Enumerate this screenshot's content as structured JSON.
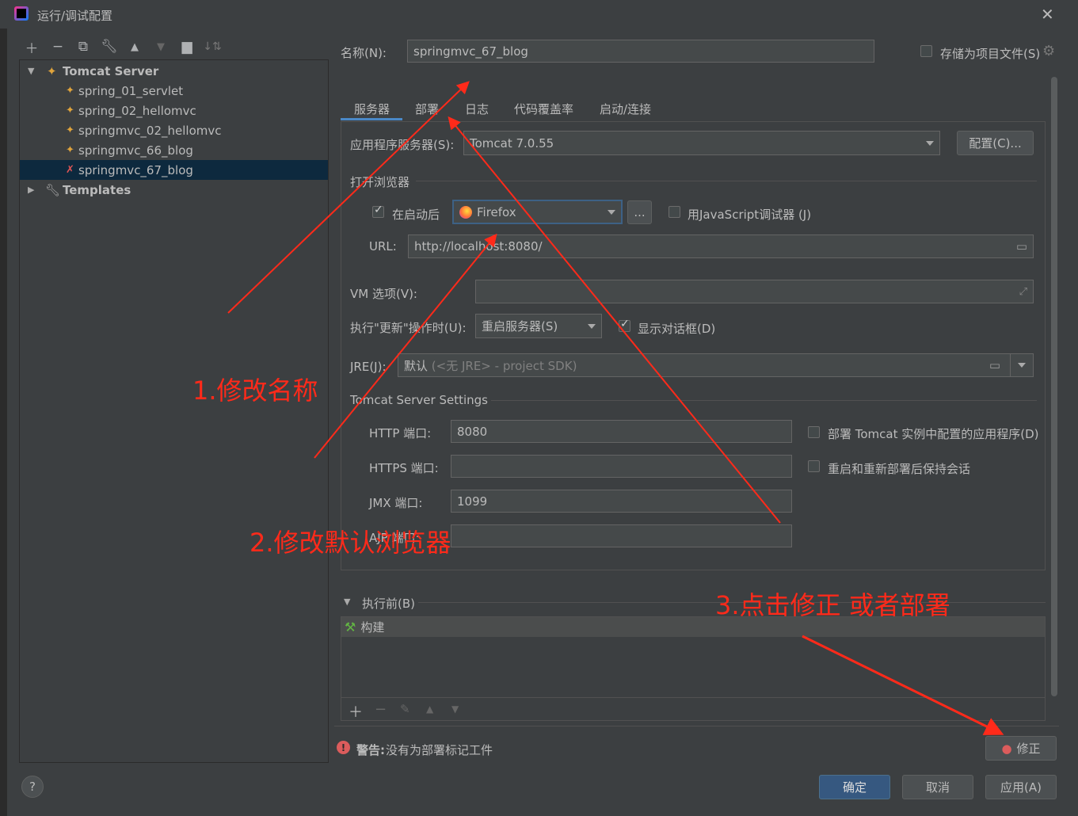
{
  "window": {
    "title": "运行/调试配置",
    "close": "✕"
  },
  "toolbar": {
    "icons": [
      "plus-icon",
      "minus-icon",
      "copy-icon",
      "wrench-icon",
      "arrow-up-icon",
      "arrow-down-icon",
      "folder-add-icon",
      "sort-icon"
    ]
  },
  "tree": {
    "group": "Tomcat Server",
    "items": [
      "spring_01_servlet",
      "spring_02_hellomvc",
      "springmvc_02_hellomvc",
      "springmvc_66_blog",
      "springmvc_67_blog"
    ],
    "selected": "springmvc_67_blog",
    "templates": "Templates"
  },
  "name": {
    "label": "名称(N):",
    "value": "springmvc_67_blog"
  },
  "store": {
    "label": "存储为项目文件(S)"
  },
  "tabs": [
    "服务器",
    "部署",
    "日志",
    "代码覆盖率",
    "启动/连接"
  ],
  "server": {
    "app_server_label": "应用程序服务器(S):",
    "app_server_value": "Tomcat 7.0.55",
    "config_button": "配置(C)...",
    "open_browser_label": "打开浏览器",
    "after_launch_label": "在启动后",
    "browser_value": "Firefox",
    "browse_btn": "...",
    "js_debugger_label": "用JavaScript调试器 (J)",
    "url_label": "URL:",
    "url_value": "http://localhost:8080/",
    "vm_label": "VM 选项(V):",
    "vm_value": "",
    "update_label": "执行\"更新\"操作时(U):",
    "update_value": "重启服务器(S)",
    "show_dialog_label": "显示对话框(D)",
    "jre_label": "JRE(J):",
    "jre_value_main": "默认",
    "jre_value_hint": "(<无 JRE> - project SDK)",
    "tomcat_settings_label": "Tomcat Server Settings",
    "http_label": "HTTP 端口:",
    "http_value": "8080",
    "https_label": "HTTPS 端口:",
    "https_value": "",
    "jmx_label": "JMX 端口:",
    "jmx_value": "1099",
    "ajp_label": "AJP 端口:",
    "ajp_value": "",
    "deploy_tomcat_label": "部署 Tomcat 实例中配置的应用程序(D)",
    "keep_session_label": "重启和重新部署后保持会话"
  },
  "before_launch": {
    "label": "执行前(B)",
    "items": [
      "构建"
    ]
  },
  "warning": {
    "prefix": "警告:",
    "text": "没有为部署标记工件",
    "fix_button": "修正"
  },
  "footer": {
    "ok": "确定",
    "cancel": "取消",
    "apply": "应用(A)",
    "help": "?"
  },
  "annotations": {
    "a1": "1.修改名称",
    "a2": "2.修改默认浏览器",
    "a3": "3.点击修正 或者部署"
  },
  "colors": {
    "accent": "#4a88c7",
    "selection": "#0d293e",
    "warning": "#db5c5c",
    "annotation": "#ff2a1a"
  }
}
